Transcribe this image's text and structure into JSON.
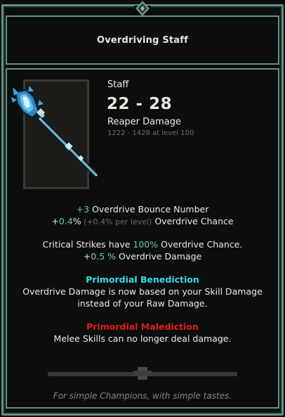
{
  "item": {
    "name": "Overdriving Staff",
    "type": "Staff",
    "damage_range": "22 - 28",
    "damage_label": "Reaper Damage",
    "level_range": "1222 - 1428 at level 100"
  },
  "stats": {
    "bounce_value": "+3",
    "bounce_label": " Overdrive Bounce Number",
    "chance_prefix": "+",
    "chance_value": "0.4",
    "chance_unit": "%",
    "chance_per_level": " (+0.4% per level)",
    "chance_label": " Overdrive Chance",
    "crit_prefix": "Critical Strikes have ",
    "crit_value": "100%",
    "crit_suffix": " Overdrive Chance.",
    "od_prefix": "+",
    "od_value": "0.5 %",
    "od_label": " Overdrive Damage"
  },
  "benediction": {
    "title": "Primordial Benediction",
    "line1": "Overdrive Damage is now based on your Skill Damage",
    "line2": "instead of your Raw Damage."
  },
  "malediction": {
    "title": "Primordial Malediction",
    "line1": "Melee Skills can no longer deal damage."
  },
  "flavor": "For simple Champions, with simple tastes.",
  "colors": {
    "border": "#5f9186",
    "teal_value": "#67c6bd",
    "benediction": "#34dbe6",
    "malediction": "#e21c1c"
  },
  "icons": {
    "weapon": "ice-staff-icon",
    "top_ornament": "diamond-gem-icon"
  }
}
